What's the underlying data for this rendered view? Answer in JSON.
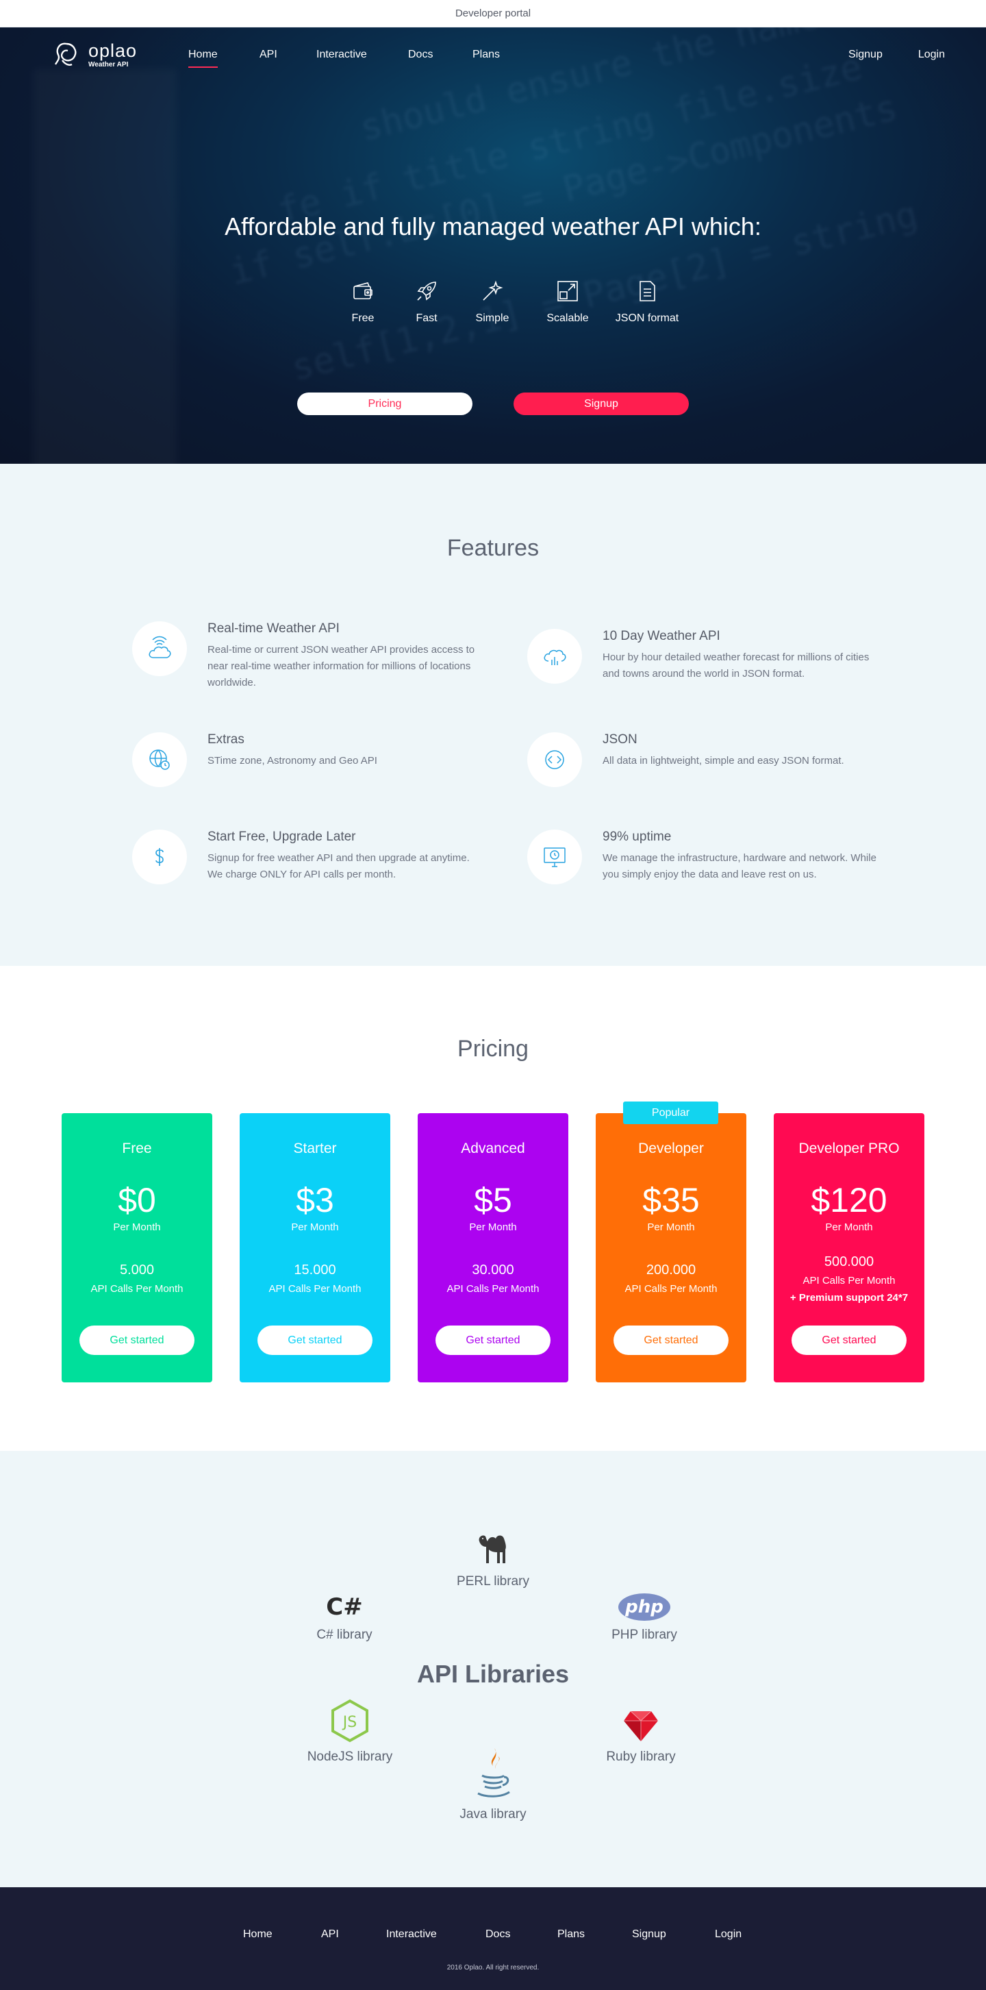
{
  "topbar": {
    "title": "Developer portal"
  },
  "brand": {
    "name": "oplao",
    "tagline": "Weather API"
  },
  "nav": {
    "links": [
      "Home",
      "API",
      "Interactive",
      "Docs",
      "Plans"
    ],
    "right": [
      "Signup",
      "Login"
    ]
  },
  "hero": {
    "title": "Affordable and fully managed weather API which:",
    "icons": [
      {
        "label": "Free",
        "icon": "wallet-icon"
      },
      {
        "label": "Fast",
        "icon": "rocket-icon"
      },
      {
        "label": "Simple",
        "icon": "magic-wand-icon"
      },
      {
        "label": "Scalable",
        "icon": "expand-icon"
      },
      {
        "label": "JSON format",
        "icon": "document-icon"
      }
    ],
    "pricing_button": "Pricing",
    "signup_button": "Signup"
  },
  "features": {
    "title": "Features",
    "items": [
      {
        "title": "Real-time Weather API",
        "text": "Real-time or current JSON weather API provides access to near real-time weather information for millions of locations worldwide.",
        "icon": "cloud-wifi-icon"
      },
      {
        "title": "10 Day Weather API",
        "text": "Hour by hour detailed weather forecast for millions of cities and towns around the world in JSON format.",
        "icon": "cloud-chart-icon"
      },
      {
        "title": "Extras",
        "text": "STime zone, Astronomy and Geo API",
        "icon": "globe-clock-icon"
      },
      {
        "title": "JSON",
        "text": "All data in lightweight, simple and easy JSON format.",
        "icon": "code-icon"
      },
      {
        "title": "Start Free, Upgrade Later",
        "text": "Signup for free weather API and then upgrade at anytime. We charge ONLY for API calls per month.",
        "icon": "dollar-icon"
      },
      {
        "title": "99% uptime",
        "text": "We manage the infrastructure, hardware and network. While you simply enjoy the data and leave rest on us.",
        "icon": "monitor-clock-icon"
      }
    ],
    "icon_color": "#29a3e0"
  },
  "pricing": {
    "title": "Pricing",
    "popular": "Popular",
    "plans": [
      {
        "name": "Free",
        "price": "$0",
        "per": "Per Month",
        "calls": "5.000",
        "calls_label": "API Calls Per Month",
        "extra": "",
        "cta": "Get started",
        "color": "#00df9b"
      },
      {
        "name": "Starter",
        "price": "$3",
        "per": "Per Month",
        "calls": "15.000",
        "calls_label": "API Calls Per Month",
        "extra": "",
        "cta": "Get started",
        "color": "#0bd1f7"
      },
      {
        "name": "Advanced",
        "price": "$5",
        "per": "Per Month",
        "calls": "30.000",
        "calls_label": "API Calls Per Month",
        "extra": "",
        "cta": "Get started",
        "color": "#ac03f0"
      },
      {
        "name": "Developer",
        "price": "$35",
        "per": "Per Month",
        "calls": "200.000",
        "calls_label": "API Calls Per Month",
        "extra": "",
        "cta": "Get started",
        "color": "#ff6e07"
      },
      {
        "name": "Developer PRO",
        "price": "$120",
        "per": "Per Month",
        "calls": "500.000",
        "calls_label": "API Calls Per Month",
        "extra": "+ Premium support 24*7",
        "cta": "Get started",
        "color": "#ff0a52"
      }
    ]
  },
  "libraries": {
    "title": "API Libraries",
    "items": [
      {
        "label": "PERL library",
        "icon": "camel-icon"
      },
      {
        "label": "C# library",
        "icon": "csharp-icon",
        "logo_text": "C#"
      },
      {
        "label": "PHP library",
        "icon": "php-icon",
        "logo_text": "php"
      },
      {
        "label": "NodeJS library",
        "icon": "nodejs-icon",
        "logo_text": "JS"
      },
      {
        "label": "Ruby library",
        "icon": "ruby-icon"
      },
      {
        "label": "Java library",
        "icon": "java-icon"
      }
    ]
  },
  "footer": {
    "links": [
      "Home",
      "API",
      "Interactive",
      "Docs",
      "Plans",
      "Signup",
      "Login"
    ],
    "copyright": "2016 Oplao. All right reserved."
  }
}
